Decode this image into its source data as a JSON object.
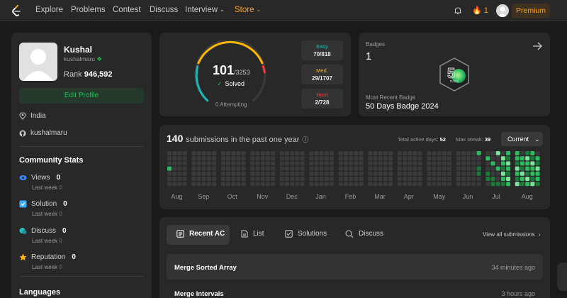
{
  "nav": {
    "items": [
      "Explore",
      "Problems",
      "Contest",
      "Discuss",
      "Interview",
      "Store"
    ],
    "streak": "1",
    "premium": "Premium"
  },
  "profile": {
    "name": "Kushal",
    "handle": "kushalmaru",
    "rank_label": "Rank",
    "rank": "946,592",
    "edit": "Edit Profile",
    "location": "India",
    "github": "kushalmaru"
  },
  "community": {
    "title": "Community Stats",
    "stats": [
      {
        "label": "Views",
        "value": "0",
        "sub": "Last week",
        "delta": "0",
        "color": "#3a8bfd"
      },
      {
        "label": "Solution",
        "value": "0",
        "sub": "Last week",
        "delta": "0",
        "color": "#3aaefd"
      },
      {
        "label": "Discuss",
        "value": "0",
        "sub": "Last week",
        "delta": "0",
        "color": "#2cbbba"
      },
      {
        "label": "Reputation",
        "value": "0",
        "sub": "Last week",
        "delta": "0",
        "color": "#ffb800"
      }
    ]
  },
  "languages": {
    "title": "Languages"
  },
  "solved": {
    "count": "101",
    "total": "/3253",
    "label": "Solved",
    "attempting": "0 Attempting",
    "difficulties": [
      {
        "label": "Easy",
        "value": "70/818",
        "color": "#1cbaba"
      },
      {
        "label": "Med.",
        "value": "29/1707",
        "color": "#ffb700"
      },
      {
        "label": "Hard",
        "value": "2/728",
        "color": "#f63737"
      }
    ]
  },
  "badges": {
    "label": "Badges",
    "count": "1",
    "recent_label": "Most Recent Badge",
    "recent": "50 Days Badge 2024",
    "badge_text": "DAYS"
  },
  "submissions": {
    "count": "140",
    "text": "submissions in the past one year",
    "active_label": "Total active days:",
    "active": "52",
    "streak_label": "Max streak:",
    "streak": "39",
    "selector": "Current",
    "months": [
      "Aug",
      "Sep",
      "Oct",
      "Nov",
      "Dec",
      "Jan",
      "Feb",
      "Mar",
      "Apr",
      "May",
      "Jun",
      "Jul",
      "Aug"
    ]
  },
  "recent": {
    "tabs": [
      "Recent AC",
      "List",
      "Solutions",
      "Discuss"
    ],
    "view_all": "View all submissions",
    "rows": [
      {
        "title": "Merge Sorted Array",
        "ago": "34 minutes ago"
      },
      {
        "title": "Merge Intervals",
        "ago": "3 hours ago"
      }
    ]
  }
}
